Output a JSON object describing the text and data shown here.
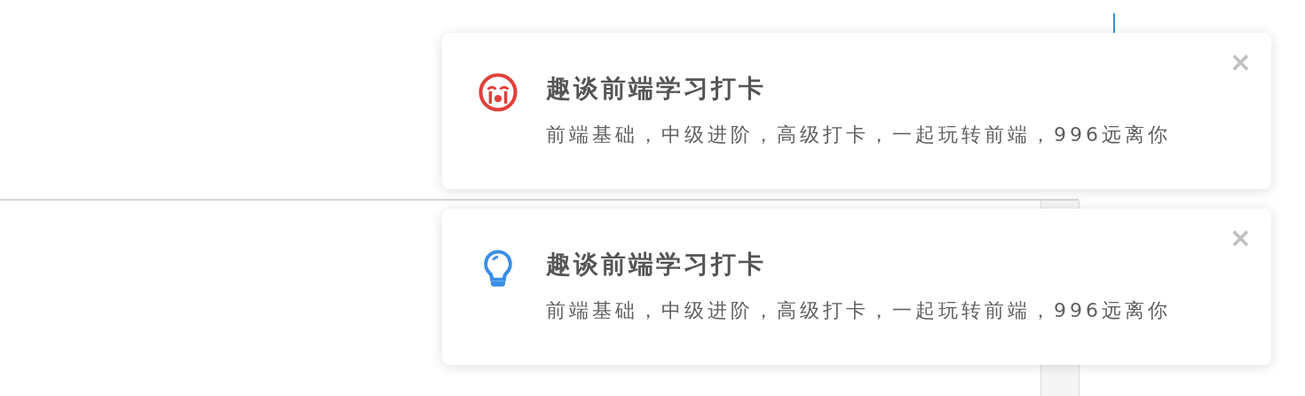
{
  "notifications": [
    {
      "kind": "error",
      "title": "趣谈前端学习打卡",
      "message": "前端基础，中级进阶，高级打卡，一起玩转前端，996远离你",
      "close": "×"
    },
    {
      "kind": "info",
      "title": "趣谈前端学习打卡",
      "message": "前端基础，中级进阶，高级打卡，一起玩转前端，996远离你",
      "close": "×"
    }
  ]
}
